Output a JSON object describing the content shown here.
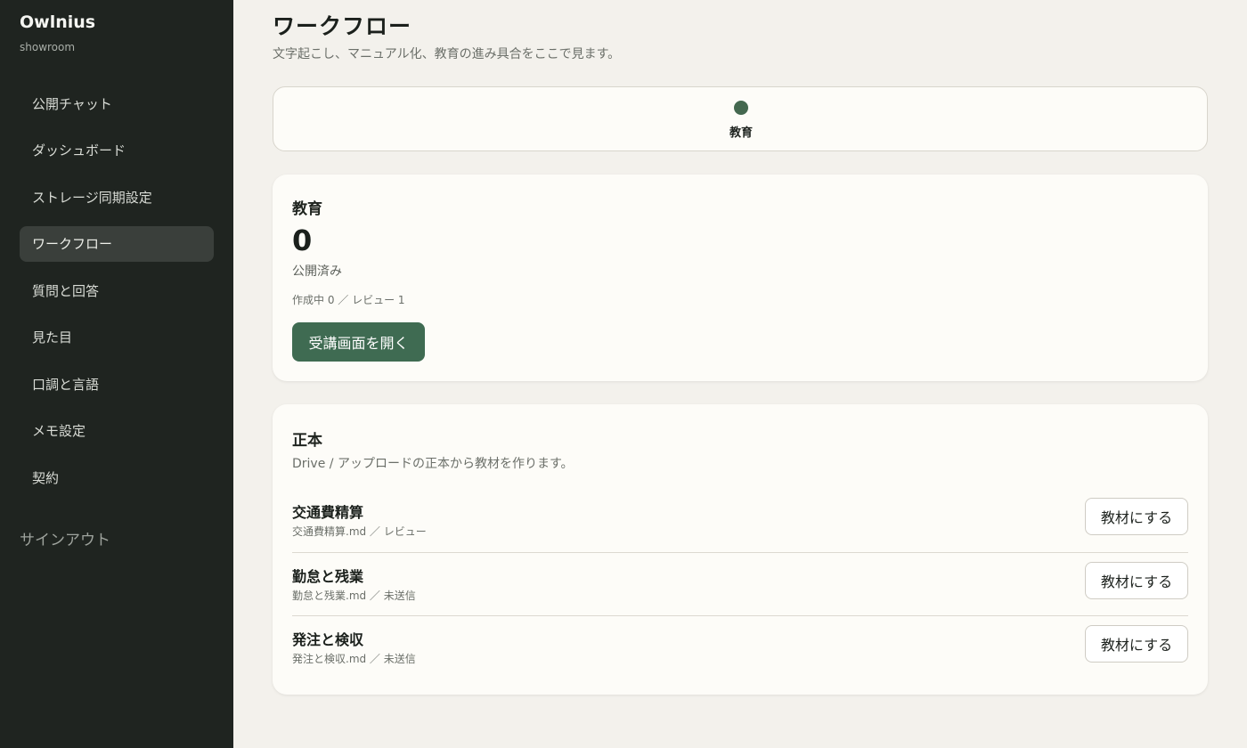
{
  "sidebar": {
    "brand": "Owlnius",
    "brand_sub": "showroom",
    "items": [
      {
        "label": "公開チャット"
      },
      {
        "label": "ダッシュボード"
      },
      {
        "label": "ストレージ同期設定"
      },
      {
        "label": "ワークフロー",
        "active": true
      },
      {
        "label": "質問と回答"
      },
      {
        "label": "見た目"
      },
      {
        "label": "口調と言語"
      },
      {
        "label": "メモ設定"
      },
      {
        "label": "契約"
      }
    ],
    "signout": "サインアウト"
  },
  "main": {
    "title": "ワークフロー",
    "subtitle": "文字起こし、マニュアル化、教育の進み具合をここで見ます。",
    "stepper": {
      "label": "教育"
    },
    "education": {
      "title": "教育",
      "published_count": "0",
      "published_label": "公開済み",
      "meta": "作成中 0 ／ レビュー 1",
      "open_button": "受講画面を開く"
    },
    "source": {
      "title": "正本",
      "description": "Drive / アップロードの正本から教材を作ります。",
      "docs": [
        {
          "title": "交通費精算",
          "meta": "交通費精算.md ／ レビュー",
          "button": "教材にする"
        },
        {
          "title": "勤怠と残業",
          "meta": "勤怠と残業.md ／ 未送信",
          "button": "教材にする"
        },
        {
          "title": "発注と検収",
          "meta": "発注と検収.md ／ 未送信",
          "button": "教材にする"
        }
      ]
    }
  },
  "colors": {
    "sidebar_bg": "#1f2420",
    "accent": "#3f6b52",
    "page_bg": "#f3f1ec"
  }
}
